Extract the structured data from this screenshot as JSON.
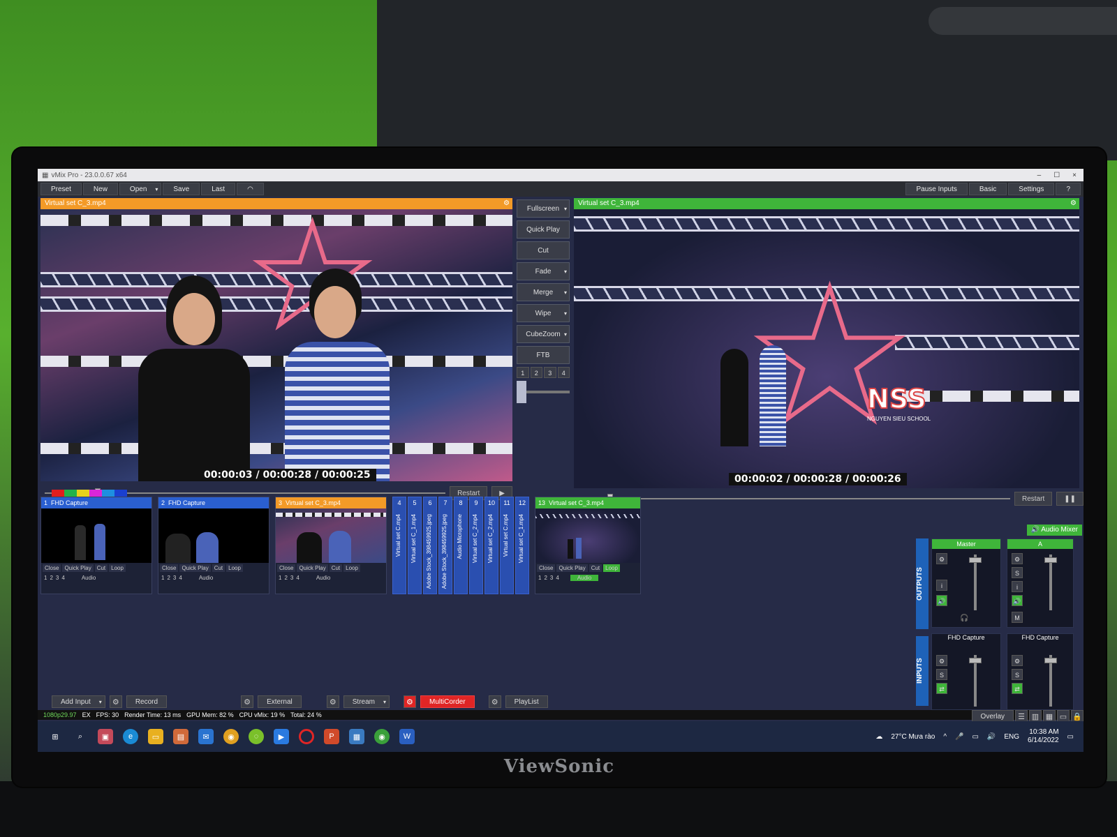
{
  "app": {
    "title": "vMix Pro - 23.0.0.67 x64"
  },
  "monitor": {
    "brand": "ViewSonic"
  },
  "menubar": {
    "preset": "Preset",
    "new": "New",
    "open": "Open",
    "save": "Save",
    "last": "Last",
    "pause_inputs": "Pause Inputs",
    "basic": "Basic",
    "settings": "Settings",
    "help": "?"
  },
  "preview": {
    "label": "Virtual set C_3.mp4",
    "timecode": "00:00:03 / 00:00:28 / 00:00:25",
    "restart": "Restart",
    "swatch_colors": [
      "#e01e1e",
      "#22b24a",
      "#e8d21a",
      "#d926d9",
      "#1e8fe0",
      "#1a3fd0"
    ]
  },
  "output": {
    "label": "Virtual set C_3.mp4",
    "timecode": "00:00:02 / 00:00:28 / 00:00:26",
    "restart": "Restart",
    "logo_text": "NSS",
    "logo_sub": "NGUYEN SIEU SCHOOL"
  },
  "transitions": {
    "fullscreen": "Fullscreen",
    "quick_play": "Quick Play",
    "cut": "Cut",
    "fade": "Fade",
    "merge": "Merge",
    "wipe": "Wipe",
    "cubezoom": "CubeZoom",
    "ftb": "FTB",
    "nums": [
      "1",
      "2",
      "3",
      "4"
    ]
  },
  "inputs": [
    {
      "num": "1",
      "name": "FHD Capture",
      "color": "#2a5fd0"
    },
    {
      "num": "2",
      "name": "FHD Capture",
      "color": "#2a5fd0"
    },
    {
      "num": "3",
      "name": "Virtual set C_3.mp4",
      "color": "#f39a27"
    },
    {
      "num": "13",
      "name": "Virtual set C_3.mp4",
      "color": "#3fb53a"
    }
  ],
  "input_controls": {
    "close": "Close",
    "quick_play": "Quick Play",
    "cut": "Cut",
    "loop": "Loop",
    "audio": "Audio",
    "nums": [
      "1",
      "2",
      "3",
      "4"
    ]
  },
  "mini_inputs": [
    {
      "num": "4",
      "name": "Virtual set C.mp4"
    },
    {
      "num": "5",
      "name": "Virtual set C_1.mp4"
    },
    {
      "num": "6",
      "name": "Adobe Stock_398459925.jpeg"
    },
    {
      "num": "7",
      "name": "Adobe Stock_398459925.jpeg"
    },
    {
      "num": "8",
      "name": "Audio Microphone"
    },
    {
      "num": "9",
      "name": "Virtual set C_2.mp4"
    },
    {
      "num": "10",
      "name": "Virtual set C_2.mp4"
    },
    {
      "num": "11",
      "name": "Virtual set C.mp4"
    },
    {
      "num": "12",
      "name": "Virtual set C_1.mp4"
    }
  ],
  "mixer": {
    "title": "Audio Mixer",
    "outputs_label": "OUTPUTS",
    "inputs_label": "INPUTS",
    "master": "Master",
    "bus_a": "A",
    "strip1": "FHD Capture",
    "strip2": "FHD Capture",
    "s": "S",
    "m": "M"
  },
  "bottom": {
    "add_input": "Add Input",
    "record": "Record",
    "external": "External",
    "stream": "Stream",
    "multicorder": "MultiCorder",
    "playlist": "PlayList",
    "overlay": "Overlay"
  },
  "status": {
    "format": "1080p29.97",
    "ex": "EX",
    "fps": "FPS:  30",
    "render": "Render Time:  13 ms",
    "gpu": "GPU Mem:  82 %",
    "cpu": "CPU vMix:  19 %",
    "total": "Total:  24 %"
  },
  "taskbar": {
    "weather": "27°C  Mưa rào",
    "lang": "ENG",
    "time": "10:38 AM",
    "date": "6/14/2022"
  }
}
